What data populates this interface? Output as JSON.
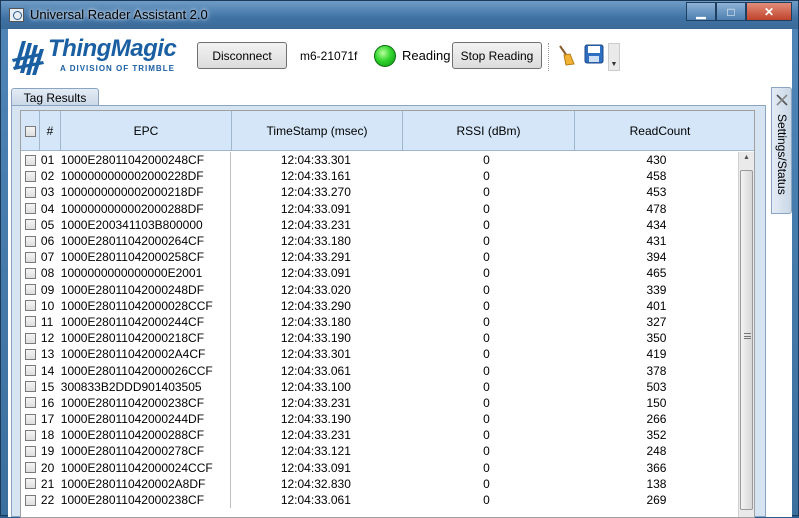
{
  "window": {
    "title": "Universal Reader Assistant 2.0",
    "minimize": "▁",
    "maximize": "□",
    "close": "✕"
  },
  "brand": {
    "name": "ThingMagic",
    "tagline": "A DIVISION OF TRIMBLE"
  },
  "toolbar": {
    "disconnect_label": "Disconnect",
    "reader_name": "m6-21071f",
    "status_label": "Reading",
    "status_color": "#31d52c",
    "stop_label": "Stop Reading"
  },
  "tabs": {
    "tag_results": "Tag Results",
    "settings_status": "Settings/Status"
  },
  "grid": {
    "columns": [
      "#",
      "EPC",
      "TimeStamp (msec)",
      "RSSI (dBm)",
      "ReadCount"
    ],
    "rows": [
      [
        "01",
        "1000E28011042000248CF",
        "12:04:33.301",
        "0",
        "430"
      ],
      [
        "02",
        "1000000000002000228DF",
        "12:04:33.161",
        "0",
        "458"
      ],
      [
        "03",
        "1000000000002000218DF",
        "12:04:33.270",
        "0",
        "453"
      ],
      [
        "04",
        "1000000000002000288DF",
        "12:04:33.091",
        "0",
        "478"
      ],
      [
        "05",
        "1000E200341103B800000",
        "12:04:33.231",
        "0",
        "434"
      ],
      [
        "06",
        "1000E28011042000264CF",
        "12:04:33.180",
        "0",
        "431"
      ],
      [
        "07",
        "1000E28011042000258CF",
        "12:04:33.291",
        "0",
        "394"
      ],
      [
        "08",
        "1000000000000000E2001",
        "12:04:33.091",
        "0",
        "465"
      ],
      [
        "09",
        "1000E28011042000248DF",
        "12:04:33.020",
        "0",
        "339"
      ],
      [
        "10",
        "1000E28011042000028CCF",
        "12:04:33.290",
        "0",
        "401"
      ],
      [
        "11",
        "1000E28011042000244CF",
        "12:04:33.180",
        "0",
        "327"
      ],
      [
        "12",
        "1000E28011042000218CF",
        "12:04:33.190",
        "0",
        "350"
      ],
      [
        "13",
        "1000E280110420002A4CF",
        "12:04:33.301",
        "0",
        "419"
      ],
      [
        "14",
        "1000E28011042000026CCF",
        "12:04:33.061",
        "0",
        "378"
      ],
      [
        "15",
        "300833B2DDD901403505",
        "12:04:33.100",
        "0",
        "503"
      ],
      [
        "16",
        "1000E28011042000238CF",
        "12:04:33.231",
        "0",
        "150"
      ],
      [
        "17",
        "1000E28011042000244DF",
        "12:04:33.190",
        "0",
        "266"
      ],
      [
        "18",
        "1000E28011042000288CF",
        "12:04:33.231",
        "0",
        "352"
      ],
      [
        "19",
        "1000E28011042000278CF",
        "12:04:33.121",
        "0",
        "248"
      ],
      [
        "20",
        "1000E28011042000024CCF",
        "12:04:33.091",
        "0",
        "366"
      ],
      [
        "21",
        "1000E280110420002A8DF",
        "12:04:32.830",
        "0",
        "138"
      ],
      [
        "22",
        "1000E28011042000238CF",
        "12:04:33.061",
        "0",
        "269"
      ]
    ]
  }
}
